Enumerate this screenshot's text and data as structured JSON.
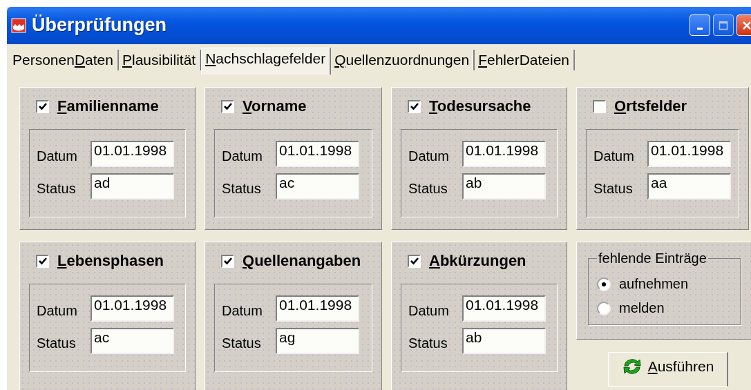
{
  "window": {
    "title": "Überprüfungen"
  },
  "tabs": [
    {
      "pre": "Personen",
      "key": "D",
      "post": "aten",
      "selected": false
    },
    {
      "key": "P",
      "post": "lausibilität",
      "selected": false
    },
    {
      "key": "N",
      "post": "achschlagefelder",
      "selected": true
    },
    {
      "key": "Q",
      "post": "uellenzuordnungen",
      "selected": false
    },
    {
      "key": "F",
      "post": "ehlerDateien",
      "selected": false
    }
  ],
  "groups": [
    {
      "key": "F",
      "post": "amilienname",
      "checked": true,
      "date_label": "Datum",
      "date": "01.01.1998",
      "status_label": "Status",
      "status": "ad"
    },
    {
      "key": "V",
      "post": "orname",
      "checked": true,
      "date_label": "Datum",
      "date": "01.01.1998",
      "status_label": "Status",
      "status": "ac"
    },
    {
      "key": "T",
      "post": "odesursache",
      "checked": true,
      "date_label": "Datum",
      "date": "01.01.1998",
      "status_label": "Status",
      "status": "ab"
    },
    {
      "key": "O",
      "post": "rtsfelder",
      "checked": false,
      "date_label": "Datum",
      "date": "01.01.1998",
      "status_label": "Status",
      "status": "aa"
    },
    {
      "key": "L",
      "post": "ebensphasen",
      "checked": true,
      "date_label": "Datum",
      "date": "01.01.1998",
      "status_label": "Status",
      "status": "ac"
    },
    {
      "key": "Q",
      "post": "uellenangaben",
      "checked": true,
      "date_label": "Datum",
      "date": "01.01.1998",
      "status_label": "Status",
      "status": "ag"
    },
    {
      "key": "A",
      "post": "bkürzungen",
      "checked": true,
      "date_label": "Datum",
      "date": "01.01.1998",
      "status_label": "Status",
      "status": "ab"
    }
  ],
  "missing_entries": {
    "title": "fehlende Einträge",
    "options": [
      {
        "label": "aufnehmen",
        "selected": true
      },
      {
        "label": "melden",
        "selected": false
      }
    ]
  },
  "run_button": {
    "key": "A",
    "post": "usführen"
  }
}
